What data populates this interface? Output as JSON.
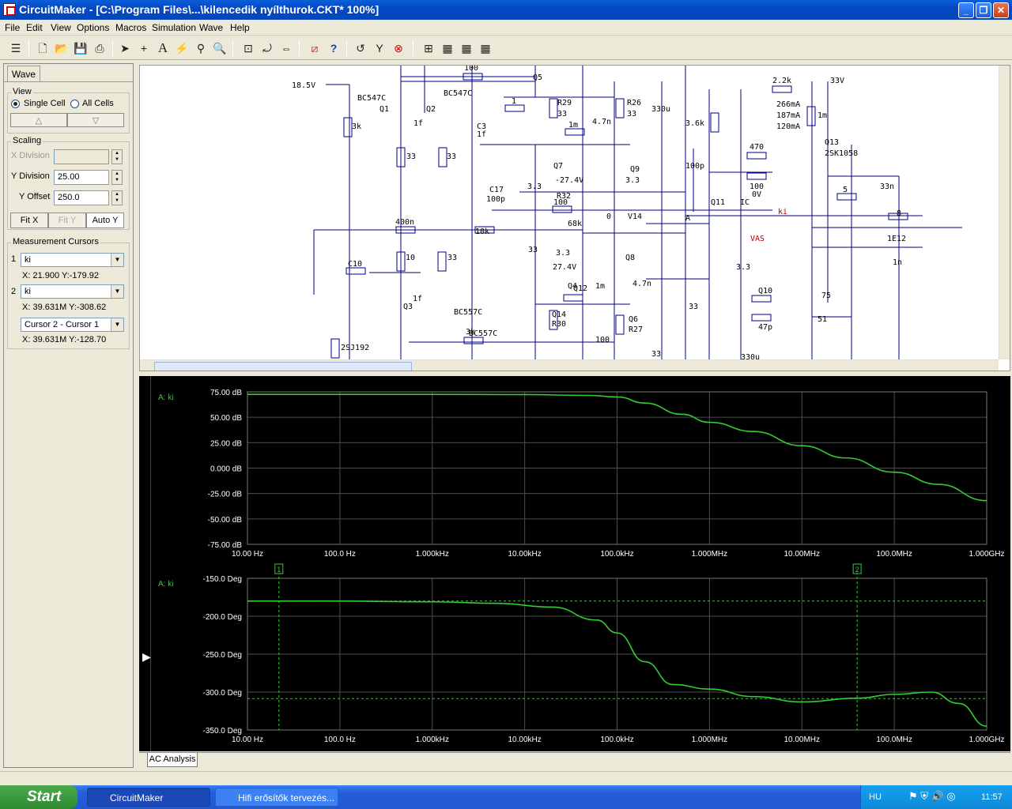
{
  "window": {
    "title": "CircuitMaker - [C:\\Program Files\\...\\kilencedik nyílthurok.CKT* 100%]",
    "minimize": "_",
    "maximize": "❐",
    "close": "✕"
  },
  "menu": [
    "File",
    "Edit",
    "View",
    "Options",
    "Macros",
    "Simulation",
    "Wave",
    "Help"
  ],
  "toolbar": {
    "icons": [
      "mode-icon",
      "new-icon",
      "open-icon",
      "save-icon",
      "print-icon",
      "arrow-icon",
      "wire-icon",
      "text-icon",
      "probe-icon",
      "zoom-probe-icon",
      "zoom-icon",
      "fit-icon",
      "rotate-icon",
      "mirror-icon",
      "digital-icon",
      "help-icon",
      "reset-icon",
      "step-icon",
      "stop-icon",
      "analog-icon",
      "wave1-icon",
      "wave2-icon",
      "wave3-icon"
    ]
  },
  "panel": {
    "tab": "Wave",
    "view": {
      "title": "View",
      "single_cell": "Single Cell",
      "all_cells": "All Cells",
      "up": "△",
      "down": "▽"
    },
    "scaling": {
      "title": "Scaling",
      "x_division_label": "X Division",
      "x_division_value": "",
      "y_division_label": "Y Division",
      "y_division_value": "25.00",
      "y_offset_label": "Y Offset",
      "y_offset_value": "250.0",
      "fit_x": "Fit X",
      "fit_y": "Fit Y",
      "auto_y": "Auto Y"
    },
    "cursors": {
      "title": "Measurement Cursors",
      "c1_num": "1",
      "c1_trace": "ki",
      "c1_readout": "X: 21.900   Y:-179.92",
      "c2_num": "2",
      "c2_trace": "ki",
      "c2_readout": "X: 39.631M  Y:-308.62",
      "diff_sel": "Cursor 2 - Cursor 1",
      "diff_readout": "X: 39.631M  Y:-128.70"
    }
  },
  "schematic": {
    "labels": [
      "18.5V",
      "BC547C",
      "Q1",
      "Q2",
      "BC547C",
      "100",
      "Q5",
      "R29",
      "33",
      "R26",
      "33",
      "1",
      "1f",
      "C3",
      "1f",
      "1m",
      "4.7n",
      "330u",
      "3.6k",
      "2.2k",
      "33V",
      "266mA",
      "187mA",
      "120mA",
      "1m",
      "Q13",
      "2SK1058",
      "3k",
      "33",
      "33",
      "Q7",
      "-27.4V",
      "3.3",
      "C17",
      "100p",
      "R32",
      "100",
      "Q9",
      "3.3",
      "100p",
      "470",
      "100",
      "0V",
      "IC",
      "5",
      "33n",
      "V14",
      "0",
      "A",
      "Q11",
      "ki",
      "8",
      "400n",
      "10k",
      "68k",
      "VAS",
      "1E12",
      "1n",
      "C10",
      "10",
      "33",
      "33",
      "3.3",
      "27.4V",
      "Q8",
      "3.3",
      "Q12",
      "1f",
      "Q3",
      "BC557C",
      "BC557C",
      "Q4",
      "1m",
      "4.7n",
      "Q10",
      "75",
      "Q14",
      "R30",
      "33",
      "47p",
      "51",
      "2SJ192",
      "3k",
      "100",
      "Q6",
      "R27",
      "33",
      "330u",
      "3.6k"
    ]
  },
  "chart_data": [
    {
      "type": "line",
      "trace_label": "A: ki",
      "x_scale": "log",
      "x_ticks": [
        "10.00 Hz",
        "100.0 Hz",
        "1.000kHz",
        "10.00kHz",
        "100.0kHz",
        "1.000MHz",
        "10.00MHz",
        "100.0MHz",
        "1.000GHz"
      ],
      "y_ticks": [
        "75.00 dB",
        "50.00 dB",
        "25.00 dB",
        "0.000 dB",
        "-25.00 dB",
        "-50.00 dB",
        "-75.00 dB"
      ],
      "ylim": [
        -75,
        75
      ],
      "series": [
        {
          "color": "#33cc33",
          "x": [
            10,
            100,
            1000,
            10000,
            50000,
            100000,
            200000,
            500000,
            1000000,
            3000000,
            10000000,
            30000000,
            100000000,
            300000000,
            1000000000
          ],
          "values": [
            72.5,
            72.5,
            72.5,
            72.3,
            71.5,
            70,
            64,
            53,
            45,
            36,
            22,
            10,
            -4,
            -16,
            -32
          ]
        }
      ]
    },
    {
      "type": "line",
      "trace_label": "A: ki",
      "x_scale": "log",
      "x_ticks": [
        "10.00 Hz",
        "100.0 Hz",
        "1.000kHz",
        "10.00kHz",
        "100.0kHz",
        "1.000MHz",
        "10.00MHz",
        "100.0MHz",
        "1.000GHz"
      ],
      "y_ticks": [
        "-150.0 Deg",
        "-200.0 Deg",
        "-250.0 Deg",
        "-300.0 Deg",
        "-350.0 Deg"
      ],
      "ylim": [
        -350,
        -150
      ],
      "cursors": [
        {
          "label": "1",
          "x": 21.9,
          "y": -179.92
        },
        {
          "label": "2",
          "x": 39631000,
          "y": -308.62
        }
      ],
      "series": [
        {
          "color": "#33cc33",
          "x": [
            10,
            100,
            1000,
            5000,
            20000,
            60000,
            100000,
            200000,
            400000,
            1000000,
            3000000,
            10000000,
            40000000,
            100000000,
            250000000,
            500000000,
            1000000000
          ],
          "values": [
            -180,
            -180,
            -181,
            -183,
            -188,
            -205,
            -222,
            -260,
            -290,
            -296,
            -306,
            -313,
            -308,
            -303,
            -300,
            -315,
            -345
          ]
        }
      ]
    }
  ],
  "bottom_tab": "AC Analysis",
  "taskbar": {
    "start": "Start",
    "task1": "CircuitMaker",
    "task2": "Hifi erősítők tervezés...",
    "lang": "HU",
    "clock": "11:57"
  },
  "colors": {
    "trace": "#33cc33",
    "grid": "#4d4d4d",
    "schematic_wire": "#000080"
  }
}
